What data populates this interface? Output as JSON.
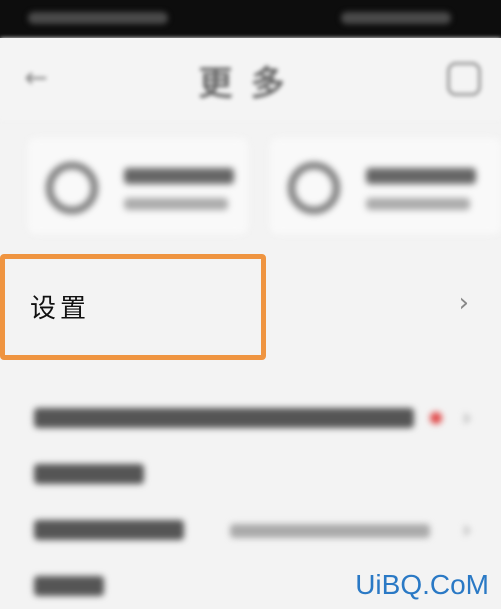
{
  "settings_row": {
    "label": "设置",
    "chevron": "›"
  },
  "status_bar": {
    "blurred": true
  },
  "nav": {
    "back_icon": "←",
    "title": "更多"
  },
  "list": {
    "chevron": "›"
  },
  "watermark": {
    "text": "UiBQ.CoM"
  },
  "colors": {
    "highlight": "#ef9440",
    "watermark": "#2a79c5",
    "badge_dot": "#e04848"
  }
}
